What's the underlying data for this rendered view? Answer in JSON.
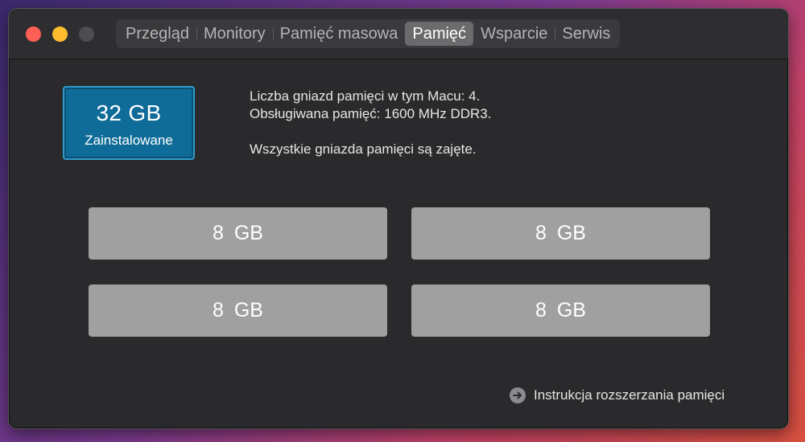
{
  "tabs": [
    {
      "label": "Przegląd"
    },
    {
      "label": "Monitory"
    },
    {
      "label": "Pamięć masowa"
    },
    {
      "label": "Pamięć",
      "active": true
    },
    {
      "label": "Wsparcie"
    },
    {
      "label": "Serwis"
    }
  ],
  "summary": {
    "size": "32 GB",
    "label": "Zainstalowane"
  },
  "info": {
    "slots_line": "Liczba gniazd pamięci w tym Macu: 4.",
    "supported_line": "Obsługiwana pamięć: 1600 MHz DDR3.",
    "status_line": "Wszystkie gniazda pamięci są zajęte."
  },
  "slots": [
    {
      "size": "8 GB"
    },
    {
      "size": "8 GB"
    },
    {
      "size": "8 GB"
    },
    {
      "size": "8 GB"
    }
  ],
  "help_link": {
    "label": "Instrukcja rozszerzania pamięci",
    "icon": "arrow-right-circle-icon"
  },
  "colors": {
    "accent_box": "#0f6c98",
    "slot": "#a0a0a0",
    "close": "#ff5f57",
    "minimize": "#febc2e"
  }
}
